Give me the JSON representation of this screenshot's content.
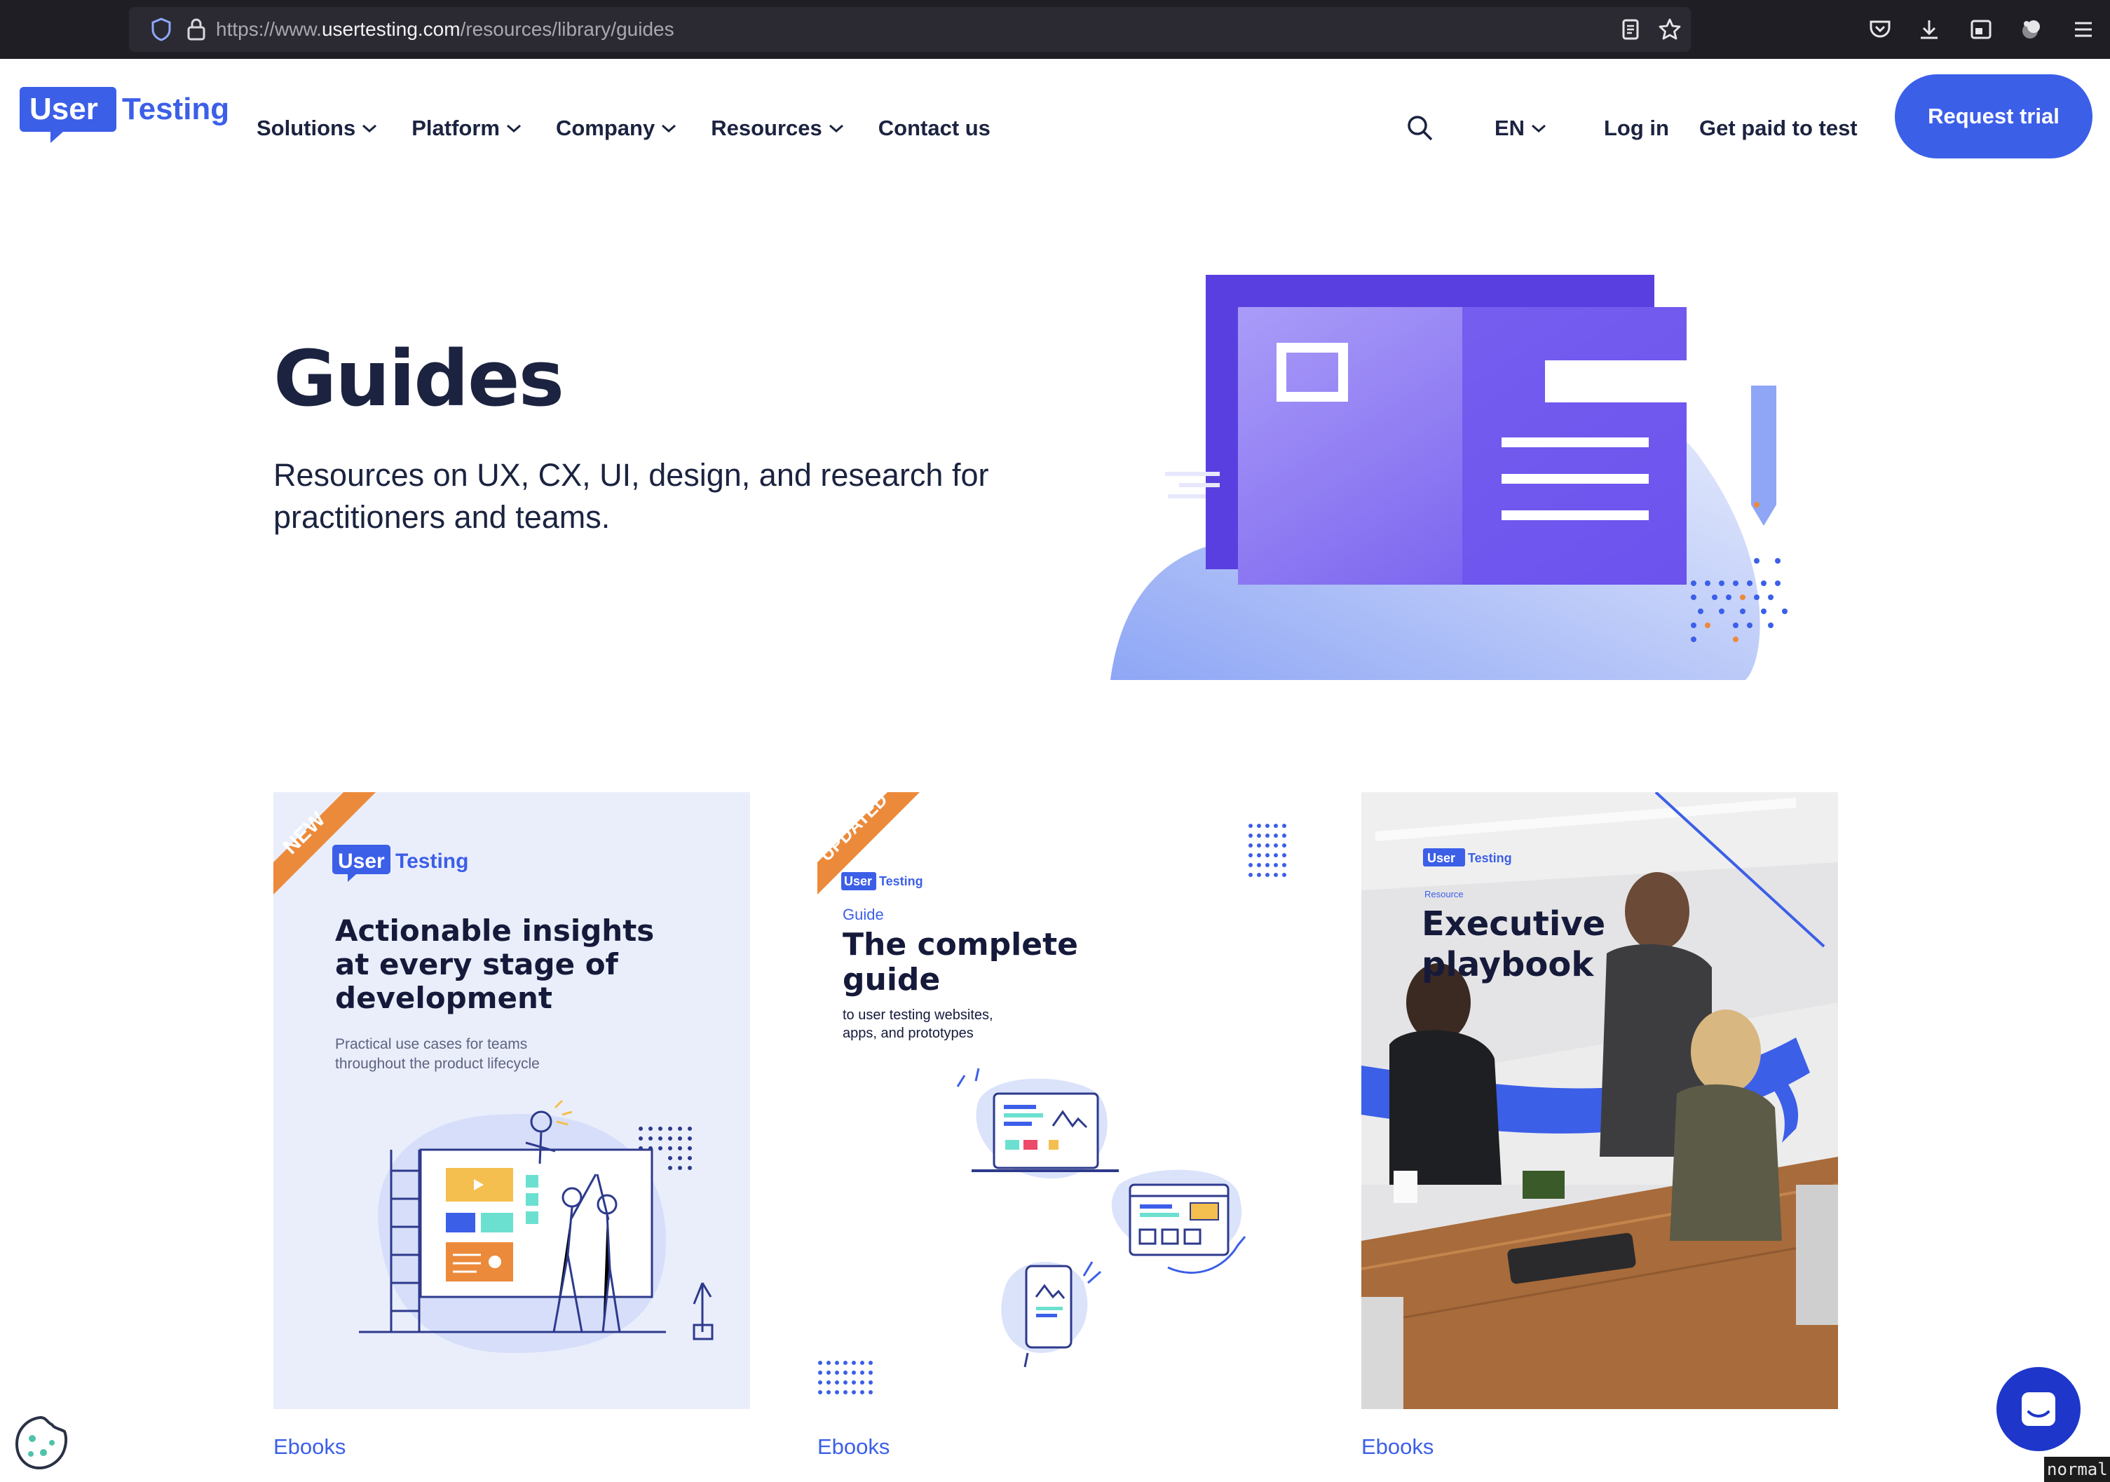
{
  "browser": {
    "url_prefix": "https://www.",
    "url_domain": "usertesting.com",
    "url_path": "/resources/library/guides",
    "icons": [
      "shield-icon",
      "lock-icon",
      "reader-view-icon",
      "bookmark-star-icon",
      "pocket-icon",
      "download-icon",
      "screenshot-icon",
      "extensions-icon",
      "menu-icon"
    ]
  },
  "nav": {
    "logo_user": "User",
    "logo_testing": "Testing",
    "items": [
      {
        "label": "Solutions",
        "dropdown": true
      },
      {
        "label": "Platform",
        "dropdown": true
      },
      {
        "label": "Company",
        "dropdown": true
      },
      {
        "label": "Resources",
        "dropdown": true
      },
      {
        "label": "Contact us",
        "dropdown": false
      }
    ],
    "language": "EN",
    "login": "Log in",
    "get_paid": "Get paid to test",
    "request_trial": "Request trial"
  },
  "hero": {
    "title": "Guides",
    "subtitle_line1": "Resources on UX, CX, UI, design, and research for",
    "subtitle_line2": "practitioners and teams."
  },
  "cards": [
    {
      "ribbon": "NEW",
      "logo_user": "User",
      "logo_testing": "Testing",
      "title_lines": [
        "Actionable insights",
        "at every stage of",
        "development"
      ],
      "sub_lines": [
        "Practical use cases for teams",
        "throughout the product lifecycle"
      ],
      "tag": "Ebooks"
    },
    {
      "ribbon": "UPDATED",
      "logo_user": "User",
      "logo_testing": "Testing",
      "kicker": "Guide",
      "title_lines": [
        "The complete",
        "guide"
      ],
      "sub_lines": [
        "to user testing websites,",
        "apps, and prototypes"
      ],
      "tag": "Ebooks"
    },
    {
      "logo_user": "User",
      "logo_testing": "Testing",
      "kicker": "Resource",
      "title_lines": [
        "Executive",
        "playbook"
      ],
      "tag": "Ebooks"
    }
  ],
  "colors": {
    "brand_blue": "#3c5fe8",
    "navy_text": "#1b2340",
    "hero_purple": "#7b61f2",
    "ribbon_orange": "#ec8a3b",
    "chat_blue": "#1e36c9"
  },
  "status_badge": "normal"
}
